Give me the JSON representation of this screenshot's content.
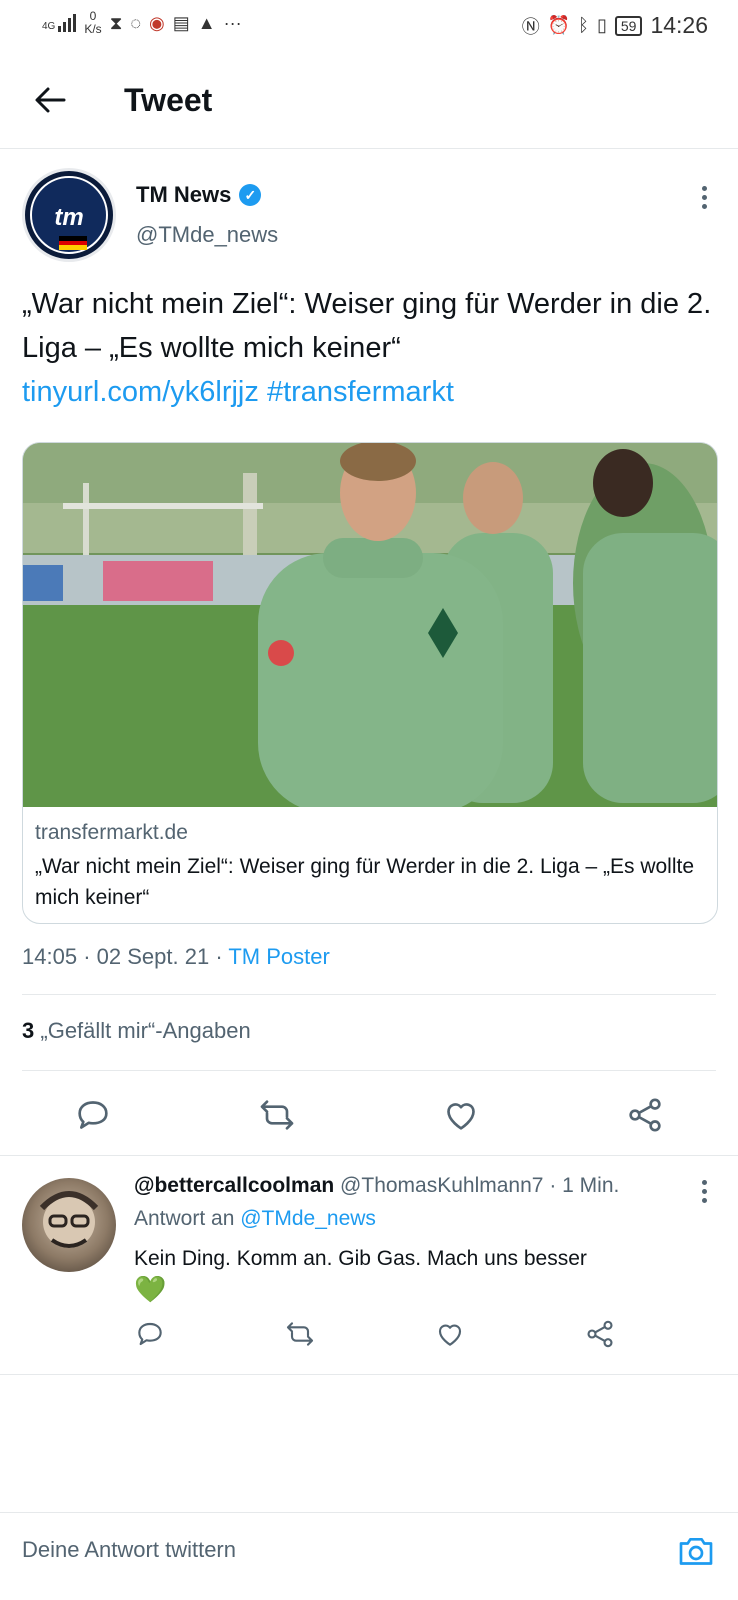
{
  "status": {
    "network": "4G",
    "speed_value": "0",
    "speed_unit": "K/s",
    "battery": "59",
    "time": "14:26"
  },
  "header": {
    "title": "Tweet"
  },
  "tweet": {
    "author_name": "TM News",
    "author_handle": "@TMde_news",
    "avatar_text": "tm",
    "text_line": "„War nicht mein Ziel“: Weiser ging für Werder in die 2. Liga – „Es wollte mich keiner“",
    "link_url": "tinyurl.com/yk6lrjjz",
    "hashtag": "#transfermarkt",
    "card_domain": "transfermarkt.de",
    "card_title": "„War nicht mein Ziel“: Weiser ging für Werder in die 2. Liga – „Es wollte mich keiner“",
    "time": "14:05",
    "date": "02 Sept. 21",
    "source": "TM Poster",
    "likes_count": "3",
    "likes_label": "„Gefällt mir“-Angaben"
  },
  "reply": {
    "name": "@bettercallcoolman",
    "handle": "@ThomasKuhlmann7",
    "age": "1 Min.",
    "reply_to_label": "Antwort an",
    "reply_to_handle": "@TMde_news",
    "text": "Kein Ding. Komm an. Gib Gas. Mach uns besser",
    "emoji": "💚"
  },
  "composer": {
    "placeholder": "Deine Antwort twittern"
  },
  "colors": {
    "accent": "#1d9bf0",
    "text": "#0f1419",
    "muted": "#536471",
    "border": "#cfd9de"
  },
  "icons": [
    "back-arrow-icon",
    "verified-icon",
    "more-icon",
    "reply-icon",
    "retweet-icon",
    "like-icon",
    "share-icon",
    "camera-icon"
  ]
}
